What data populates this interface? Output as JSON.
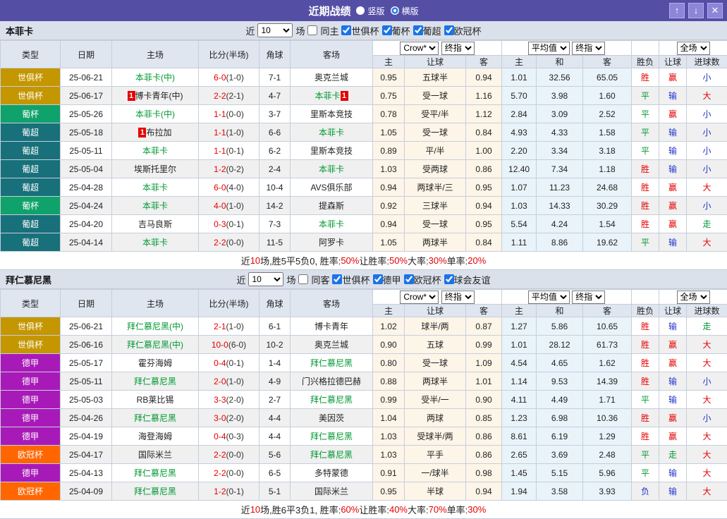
{
  "title_bar": {
    "title": "近期战绩",
    "radio_vertical": "竖版",
    "radio_horizontal": "横版",
    "up_label": "↑",
    "down_label": "↓",
    "close_label": "✕",
    "bar_color": "#554ea5"
  },
  "columns": {
    "left": [
      "类型",
      "日期",
      "主场",
      "比分(半场)",
      "角球",
      "客场"
    ],
    "group_odds": [
      "主",
      "让球",
      "客"
    ],
    "group_avg": [
      "主",
      "和",
      "客"
    ],
    "group_result": [
      "胜负",
      "让球",
      "进球数"
    ],
    "dropdown_crow": "Crow*",
    "dropdown_final1": "终指",
    "dropdown_avg": "平均值",
    "dropdown_final2": "终指",
    "dropdown_scope": "全场"
  },
  "filter_common": {
    "near": "近",
    "games": "10",
    "games_suffix": "场"
  },
  "league_colors": {
    "世俱杯": "#c49600",
    "葡杯": "#10a26b",
    "葡超": "#17707a",
    "德甲": "#a81ab8",
    "欧冠杯": "#ff6600"
  },
  "verdict_colors": {
    "胜": "#e60000",
    "平": "#009933",
    "负": "#2233cc",
    "赢": "#e60000",
    "输": "#2233cc",
    "走": "#009933",
    "大": "#e60000",
    "小": "#2233cc"
  },
  "sections": [
    {
      "team": "本菲卡",
      "same_label": "同主",
      "leagues": [
        "世俱杯",
        "葡杯",
        "葡超",
        "欧冠杯"
      ],
      "rows": [
        {
          "lg": "世俱杯",
          "dt": "25-06-21",
          "hc": "",
          "hm": "本菲卡(中)",
          "hs": 1,
          "sc": "6-0",
          "hf": "(1-0)",
          "cn": "7-1",
          "aw": "奥克兰城",
          "as": 0,
          "ac": "",
          "od": [
            "0.95",
            "五球半",
            "0.94"
          ],
          "av": [
            "1.01",
            "32.56",
            "65.05"
          ],
          "vd": [
            "胜",
            "赢",
            "小"
          ]
        },
        {
          "lg": "世俱杯",
          "dt": "25-06-17",
          "hc": "1",
          "hm": "博卡青年(中)",
          "hs": 0,
          "sc": "2-2",
          "hf": "(2-1)",
          "cn": "4-7",
          "aw": "本菲卡",
          "as": 1,
          "ac": "1",
          "od": [
            "0.75",
            "受一球",
            "1.16"
          ],
          "av": [
            "5.70",
            "3.98",
            "1.60"
          ],
          "vd": [
            "平",
            "输",
            "大"
          ]
        },
        {
          "lg": "葡杯",
          "dt": "25-05-26",
          "hc": "",
          "hm": "本菲卡(中)",
          "hs": 1,
          "sc": "1-1",
          "hf": "(0-0)",
          "cn": "3-7",
          "aw": "里斯本竞技",
          "as": 0,
          "ac": "",
          "od": [
            "0.78",
            "受平/半",
            "1.12"
          ],
          "av": [
            "2.84",
            "3.09",
            "2.52"
          ],
          "vd": [
            "平",
            "赢",
            "小"
          ]
        },
        {
          "lg": "葡超",
          "dt": "25-05-18",
          "hc": "1",
          "hm": "布拉加",
          "hs": 0,
          "sc": "1-1",
          "hf": "(1-0)",
          "cn": "6-6",
          "aw": "本菲卡",
          "as": 1,
          "ac": "",
          "od": [
            "1.05",
            "受一球",
            "0.84"
          ],
          "av": [
            "4.93",
            "4.33",
            "1.58"
          ],
          "vd": [
            "平",
            "输",
            "小"
          ]
        },
        {
          "lg": "葡超",
          "dt": "25-05-11",
          "hc": "",
          "hm": "本菲卡",
          "hs": 1,
          "sc": "1-1",
          "hf": "(0-1)",
          "cn": "6-2",
          "aw": "里斯本竞技",
          "as": 0,
          "ac": "",
          "od": [
            "0.89",
            "平/半",
            "1.00"
          ],
          "av": [
            "2.20",
            "3.34",
            "3.18"
          ],
          "vd": [
            "平",
            "输",
            "小"
          ]
        },
        {
          "lg": "葡超",
          "dt": "25-05-04",
          "hc": "",
          "hm": "埃斯托里尔",
          "hs": 0,
          "sc": "1-2",
          "hf": "(0-2)",
          "cn": "2-4",
          "aw": "本菲卡",
          "as": 1,
          "ac": "",
          "od": [
            "1.03",
            "受两球",
            "0.86"
          ],
          "av": [
            "12.40",
            "7.34",
            "1.18"
          ],
          "vd": [
            "胜",
            "输",
            "小"
          ]
        },
        {
          "lg": "葡超",
          "dt": "25-04-28",
          "hc": "",
          "hm": "本菲卡",
          "hs": 1,
          "sc": "6-0",
          "hf": "(4-0)",
          "cn": "10-4",
          "aw": "AVS俱乐部",
          "as": 0,
          "ac": "",
          "od": [
            "0.94",
            "两球半/三",
            "0.95"
          ],
          "av": [
            "1.07",
            "11.23",
            "24.68"
          ],
          "vd": [
            "胜",
            "赢",
            "大"
          ]
        },
        {
          "lg": "葡杯",
          "dt": "25-04-24",
          "hc": "",
          "hm": "本菲卡",
          "hs": 1,
          "sc": "4-0",
          "hf": "(1-0)",
          "cn": "14-2",
          "aw": "提森斯",
          "as": 0,
          "ac": "",
          "od": [
            "0.92",
            "三球半",
            "0.94"
          ],
          "av": [
            "1.03",
            "14.33",
            "30.29"
          ],
          "vd": [
            "胜",
            "赢",
            "小"
          ]
        },
        {
          "lg": "葡超",
          "dt": "25-04-20",
          "hc": "",
          "hm": "吉马良斯",
          "hs": 0,
          "sc": "0-3",
          "hf": "(0-1)",
          "cn": "7-3",
          "aw": "本菲卡",
          "as": 1,
          "ac": "",
          "od": [
            "0.94",
            "受一球",
            "0.95"
          ],
          "av": [
            "5.54",
            "4.24",
            "1.54"
          ],
          "vd": [
            "胜",
            "赢",
            "走"
          ]
        },
        {
          "lg": "葡超",
          "dt": "25-04-14",
          "hc": "",
          "hm": "本菲卡",
          "hs": 1,
          "sc": "2-2",
          "hf": "(0-0)",
          "cn": "11-5",
          "aw": "阿罗卡",
          "as": 0,
          "ac": "",
          "od": [
            "1.05",
            "两球半",
            "0.84"
          ],
          "av": [
            "1.11",
            "8.86",
            "19.62"
          ],
          "vd": [
            "平",
            "输",
            "大"
          ]
        }
      ],
      "summary": [
        [
          "近",
          0
        ],
        [
          "10",
          1
        ],
        [
          "场,胜5平5负0, 胜率:",
          0
        ],
        [
          "50%",
          1
        ],
        [
          " 让胜率:",
          0
        ],
        [
          "50%",
          1
        ],
        [
          " 大率:",
          0
        ],
        [
          "30%",
          1
        ],
        [
          " 单率:",
          0
        ],
        [
          "20%",
          1
        ]
      ]
    },
    {
      "team": "拜仁慕尼黑",
      "same_label": "同客",
      "leagues": [
        "世俱杯",
        "德甲",
        "欧冠杯",
        "球会友谊"
      ],
      "rows": [
        {
          "lg": "世俱杯",
          "dt": "25-06-21",
          "hc": "",
          "hm": "拜仁慕尼黑(中)",
          "hs": 1,
          "sc": "2-1",
          "hf": "(1-0)",
          "cn": "6-1",
          "aw": "博卡青年",
          "as": 0,
          "ac": "",
          "od": [
            "1.02",
            "球半/两",
            "0.87"
          ],
          "av": [
            "1.27",
            "5.86",
            "10.65"
          ],
          "vd": [
            "胜",
            "输",
            "走"
          ]
        },
        {
          "lg": "世俱杯",
          "dt": "25-06-16",
          "hc": "",
          "hm": "拜仁慕尼黑(中)",
          "hs": 1,
          "sc": "10-0",
          "hf": "(6-0)",
          "cn": "10-2",
          "aw": "奥克兰城",
          "as": 0,
          "ac": "",
          "od": [
            "0.90",
            "五球",
            "0.99"
          ],
          "av": [
            "1.01",
            "28.12",
            "61.73"
          ],
          "vd": [
            "胜",
            "赢",
            "大"
          ]
        },
        {
          "lg": "德甲",
          "dt": "25-05-17",
          "hc": "",
          "hm": "霍芬海姆",
          "hs": 0,
          "sc": "0-4",
          "hf": "(0-1)",
          "cn": "1-4",
          "aw": "拜仁慕尼黑",
          "as": 1,
          "ac": "",
          "od": [
            "0.80",
            "受一球",
            "1.09"
          ],
          "av": [
            "4.54",
            "4.65",
            "1.62"
          ],
          "vd": [
            "胜",
            "赢",
            "大"
          ]
        },
        {
          "lg": "德甲",
          "dt": "25-05-11",
          "hc": "",
          "hm": "拜仁慕尼黑",
          "hs": 1,
          "sc": "2-0",
          "hf": "(1-0)",
          "cn": "4-9",
          "aw": "门兴格拉德巴赫",
          "as": 0,
          "ac": "",
          "od": [
            "0.88",
            "两球半",
            "1.01"
          ],
          "av": [
            "1.14",
            "9.53",
            "14.39"
          ],
          "vd": [
            "胜",
            "输",
            "小"
          ]
        },
        {
          "lg": "德甲",
          "dt": "25-05-03",
          "hc": "",
          "hm": "RB莱比锡",
          "hs": 0,
          "sc": "3-3",
          "hf": "(2-0)",
          "cn": "2-7",
          "aw": "拜仁慕尼黑",
          "as": 1,
          "ac": "",
          "od": [
            "0.99",
            "受半/一",
            "0.90"
          ],
          "av": [
            "4.11",
            "4.49",
            "1.71"
          ],
          "vd": [
            "平",
            "输",
            "大"
          ]
        },
        {
          "lg": "德甲",
          "dt": "25-04-26",
          "hc": "",
          "hm": "拜仁慕尼黑",
          "hs": 1,
          "sc": "3-0",
          "hf": "(2-0)",
          "cn": "4-4",
          "aw": "美因茨",
          "as": 0,
          "ac": "",
          "od": [
            "1.04",
            "两球",
            "0.85"
          ],
          "av": [
            "1.23",
            "6.98",
            "10.36"
          ],
          "vd": [
            "胜",
            "赢",
            "小"
          ]
        },
        {
          "lg": "德甲",
          "dt": "25-04-19",
          "hc": "",
          "hm": "海登海姆",
          "hs": 0,
          "sc": "0-4",
          "hf": "(0-3)",
          "cn": "4-4",
          "aw": "拜仁慕尼黑",
          "as": 1,
          "ac": "",
          "od": [
            "1.03",
            "受球半/两",
            "0.86"
          ],
          "av": [
            "8.61",
            "6.19",
            "1.29"
          ],
          "vd": [
            "胜",
            "赢",
            "大"
          ]
        },
        {
          "lg": "欧冠杯",
          "dt": "25-04-17",
          "hc": "",
          "hm": "国际米兰",
          "hs": 0,
          "sc": "2-2",
          "hf": "(0-0)",
          "cn": "5-6",
          "aw": "拜仁慕尼黑",
          "as": 1,
          "ac": "",
          "od": [
            "1.03",
            "平手",
            "0.86"
          ],
          "av": [
            "2.65",
            "3.69",
            "2.48"
          ],
          "vd": [
            "平",
            "走",
            "大"
          ]
        },
        {
          "lg": "德甲",
          "dt": "25-04-13",
          "hc": "",
          "hm": "拜仁慕尼黑",
          "hs": 1,
          "sc": "2-2",
          "hf": "(0-0)",
          "cn": "6-5",
          "aw": "多特蒙德",
          "as": 0,
          "ac": "",
          "od": [
            "0.91",
            "一/球半",
            "0.98"
          ],
          "av": [
            "1.45",
            "5.15",
            "5.96"
          ],
          "vd": [
            "平",
            "输",
            "大"
          ]
        },
        {
          "lg": "欧冠杯",
          "dt": "25-04-09",
          "hc": "",
          "hm": "拜仁慕尼黑",
          "hs": 1,
          "sc": "1-2",
          "hf": "(0-1)",
          "cn": "5-1",
          "aw": "国际米兰",
          "as": 0,
          "ac": "",
          "od": [
            "0.95",
            "半球",
            "0.94"
          ],
          "av": [
            "1.94",
            "3.58",
            "3.93"
          ],
          "vd": [
            "负",
            "输",
            "大"
          ]
        }
      ],
      "summary": [
        [
          "近",
          0
        ],
        [
          "10",
          1
        ],
        [
          "场,胜6平3负1, 胜率:",
          0
        ],
        [
          "60%",
          1
        ],
        [
          " 让胜率:",
          0
        ],
        [
          "40%",
          1
        ],
        [
          " 大率:",
          0
        ],
        [
          "70%",
          1
        ],
        [
          " 单率:",
          0
        ],
        [
          "30%",
          1
        ]
      ]
    }
  ]
}
